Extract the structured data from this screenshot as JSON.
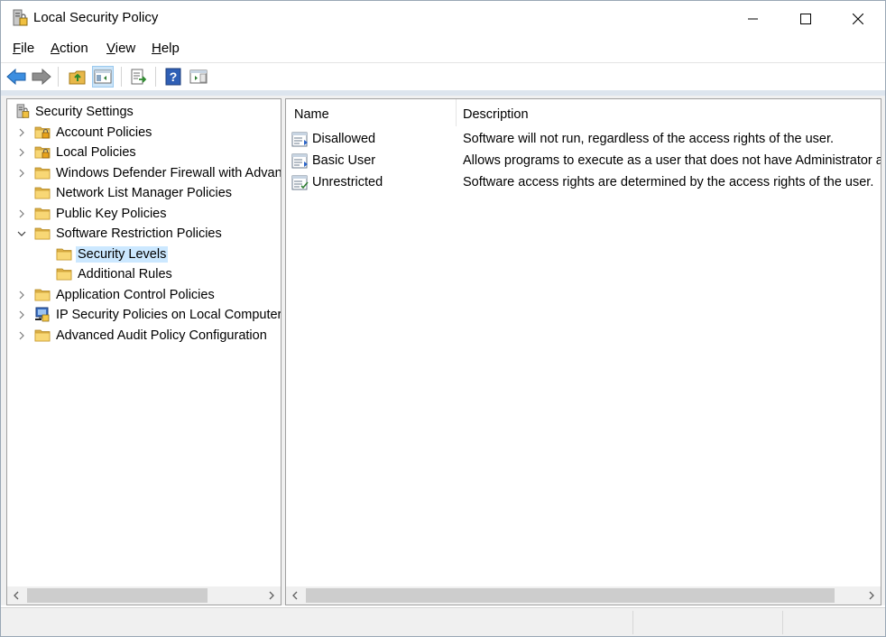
{
  "window": {
    "title": "Local Security Policy",
    "controls": [
      "minimize",
      "maximize",
      "close"
    ]
  },
  "menu": [
    {
      "label": "File"
    },
    {
      "label": "Action"
    },
    {
      "label": "View"
    },
    {
      "label": "Help"
    }
  ],
  "toolbar": {
    "buttons": [
      "back-icon",
      "forward-icon",
      "up-folder-icon",
      "show-hide-tree-icon",
      "export-list-icon",
      "help-icon",
      "show-action-pane-icon"
    ],
    "active": "show-hide-tree-icon"
  },
  "tree": {
    "root": "Security Settings",
    "items": [
      {
        "label": "Account Policies",
        "expander": "collapsed",
        "icon": "lock-folder-icon"
      },
      {
        "label": "Local Policies",
        "expander": "collapsed",
        "icon": "lock-folder-icon"
      },
      {
        "label": "Windows Defender Firewall with Advanced Security",
        "expander": "collapsed",
        "icon": "folder-icon"
      },
      {
        "label": "Network List Manager Policies",
        "expander": "none",
        "icon": "folder-icon"
      },
      {
        "label": "Public Key Policies",
        "expander": "collapsed",
        "icon": "folder-icon"
      },
      {
        "label": "Software Restriction Policies",
        "expander": "expanded",
        "icon": "folder-icon"
      },
      {
        "label": "Security Levels",
        "expander": "none",
        "icon": "folder-icon",
        "selected": true
      },
      {
        "label": "Additional Rules",
        "expander": "none",
        "icon": "folder-icon"
      },
      {
        "label": "Application Control Policies",
        "expander": "collapsed",
        "icon": "folder-icon"
      },
      {
        "label": "IP Security Policies on Local Computer",
        "expander": "collapsed",
        "icon": "ip-security-icon"
      },
      {
        "label": "Advanced Audit Policy Configuration",
        "expander": "collapsed",
        "icon": "folder-icon"
      }
    ]
  },
  "list": {
    "columns": [
      "Name",
      "Description"
    ],
    "rows": [
      {
        "name": "Disallowed",
        "description": "Software will not run, regardless of the access rights of the user."
      },
      {
        "name": "Basic User",
        "description": "Allows programs to execute as a user that does not have Administrator access rights, but can still access resources accessible by normal users."
      },
      {
        "name": "Unrestricted",
        "description": "Software access rights are determined by the access rights of the user."
      }
    ]
  },
  "colors": {
    "selection": "#cce8ff",
    "folder": "#f8d775",
    "accent": "#2b7bd6"
  }
}
